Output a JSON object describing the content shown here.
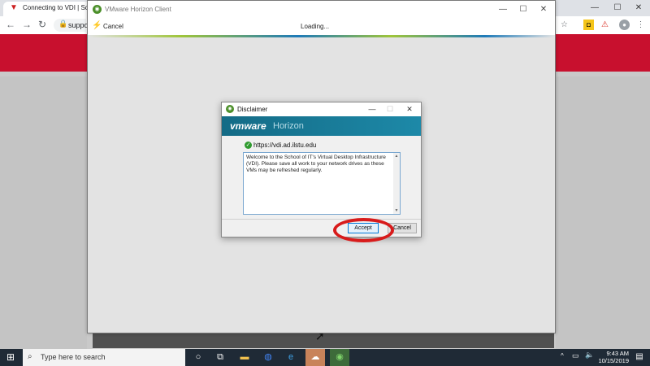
{
  "browser": {
    "tab_title": "Connecting to VDI | School",
    "address_text": "suppo",
    "window_controls": {
      "minimize": "—",
      "maximize": "☐",
      "close": "✕"
    }
  },
  "horizon_client": {
    "window_title": "VMware Horizon Client",
    "cancel_label": "Cancel",
    "status_text": "Loading...",
    "window_controls": {
      "minimize": "—",
      "maximize": "☐",
      "close": "✕"
    }
  },
  "disclaimer": {
    "title": "Disclaimer",
    "brand_vmware": "vmware",
    "brand_product": "Horizon",
    "server_url": "https://vdi.ad.ilstu.edu",
    "message": "Welcome to the School of IT's Virtual Desktop Infrastructure (VDI).  Please save all work to your network drives as these VMs may be refreshed regularly.",
    "accept_label": "Accept",
    "cancel_label": "Cancel",
    "window_controls": {
      "minimize": "—",
      "maximize": "☐",
      "close": "✕"
    }
  },
  "taskbar": {
    "search_placeholder": "Type here to search",
    "task_view_glyph": "⧉",
    "cortana_glyph": "○",
    "time": "9:43 AM",
    "date": "10/15/2019"
  },
  "colors": {
    "banner_red": "#c8102e",
    "taskbar": "#1f2a36",
    "horizon_blue": "#146b86",
    "accept_border": "#0078d7",
    "highlight_circle": "#d81b1b"
  },
  "icons": [
    "chrome-icon",
    "file-explorer-icon",
    "edge-icon",
    "horizon-client-icon",
    "cursor-icon"
  ]
}
